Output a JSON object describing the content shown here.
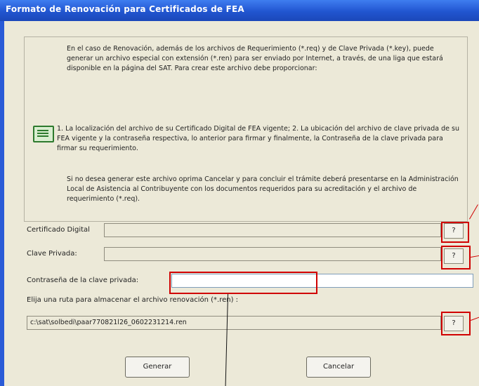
{
  "window": {
    "title": "Formato de Renovación para Certificados de FEA"
  },
  "info": {
    "p1": "En el caso de Renovación, además de los archivos de Requerimiento (*.req) y de Clave Privada (*.key), puede generar un archivo especial con extensión (*.ren) para ser enviado por Internet, a través, de una liga que estará disponible en la página del SAT. Para crear este archivo debe proporcionar:",
    "p2": "1. La localización del archivo de su Certificado Digital de FEA vigente; 2. La ubicación del archivo de clave privada de su FEA vigente y la contraseña respectiva, lo anterior para firmar y finalmente, la Contraseña de la clave privada para firmar su requerimiento.",
    "p3": "Si no desea generar este archivo oprima Cancelar y para concluir el trámite deberá presentarse en la Administración Local de Asistencia al Contribuyente con los documentos requeridos para su acreditación y el archivo de requerimiento (*.req)."
  },
  "form": {
    "cert_label": "Certificado Digital",
    "cert_value": "",
    "key_label": "Clave Privada:",
    "key_value": "",
    "password_label": "Contraseña de la clave privada:",
    "password_value": "",
    "route_label": "Elija una ruta para almacenar el archivo renovación (*.ren) :",
    "route_value": "c:\\sat\\solbedi\\paar770821l26_0602231214.ren",
    "browse_label": "?"
  },
  "buttons": {
    "generate": "Generar",
    "cancel": "Cancelar"
  },
  "colors": {
    "titlebar": "#2155d0",
    "dialog": "#ece9d8",
    "highlight": "#d00000"
  }
}
